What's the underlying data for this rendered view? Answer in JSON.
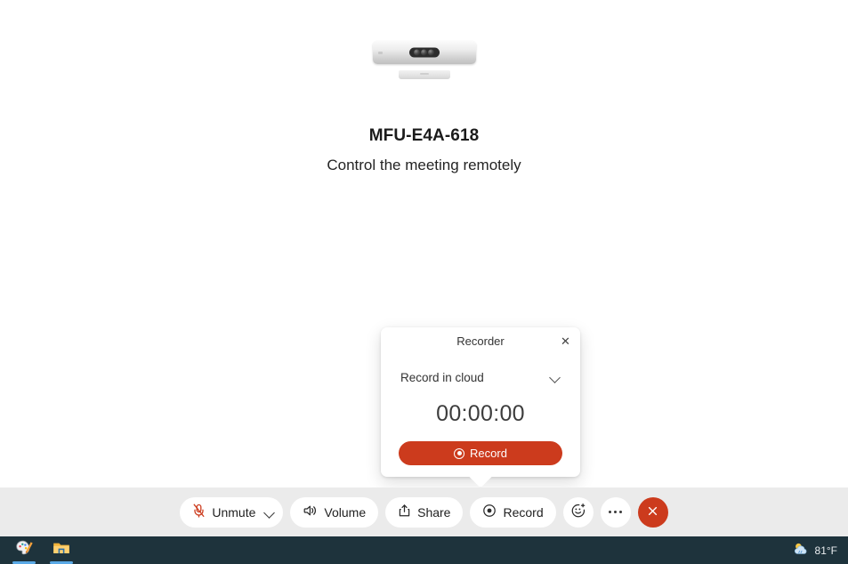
{
  "stage": {
    "device_icon": "video-bar-device",
    "device_name": "MFU-E4A-618",
    "device_subtitle": "Control the meeting remotely"
  },
  "recorder_popup": {
    "title": "Recorder",
    "close_label": "✕",
    "mode_selected": "Record in cloud",
    "mode_chevron_icon": "chevron-down-icon",
    "timer": "00:00:00",
    "record_button_label": "Record",
    "record_button_icon": "record-dot-icon",
    "accent_color": "#cc3b1d"
  },
  "toolbar": {
    "background": "#ebebeb",
    "mic_label": "Unmute",
    "mic_icon": "microphone-muted-icon",
    "mic_icon_color": "#cc3b1d",
    "mic_chevron_icon": "chevron-down-icon",
    "volume_label": "Volume",
    "volume_icon": "speaker-icon",
    "share_label": "Share",
    "share_icon": "share-upload-icon",
    "record_label": "Record",
    "record_icon": "record-dot-icon",
    "reactions_icon": "reaction-smiley-icon",
    "more_icon": "more-options-icon",
    "leave_icon": "close-x-icon",
    "leave_color": "#cc3b1d"
  },
  "taskbar": {
    "background": "#1e333c",
    "apps": [
      {
        "name": "paint-app",
        "icon": "paint-palette-icon"
      },
      {
        "name": "file-explorer-app",
        "icon": "folder-icon"
      }
    ],
    "weather": {
      "icon": "sun-behind-cloud-icon",
      "temperature": "81°F"
    }
  }
}
